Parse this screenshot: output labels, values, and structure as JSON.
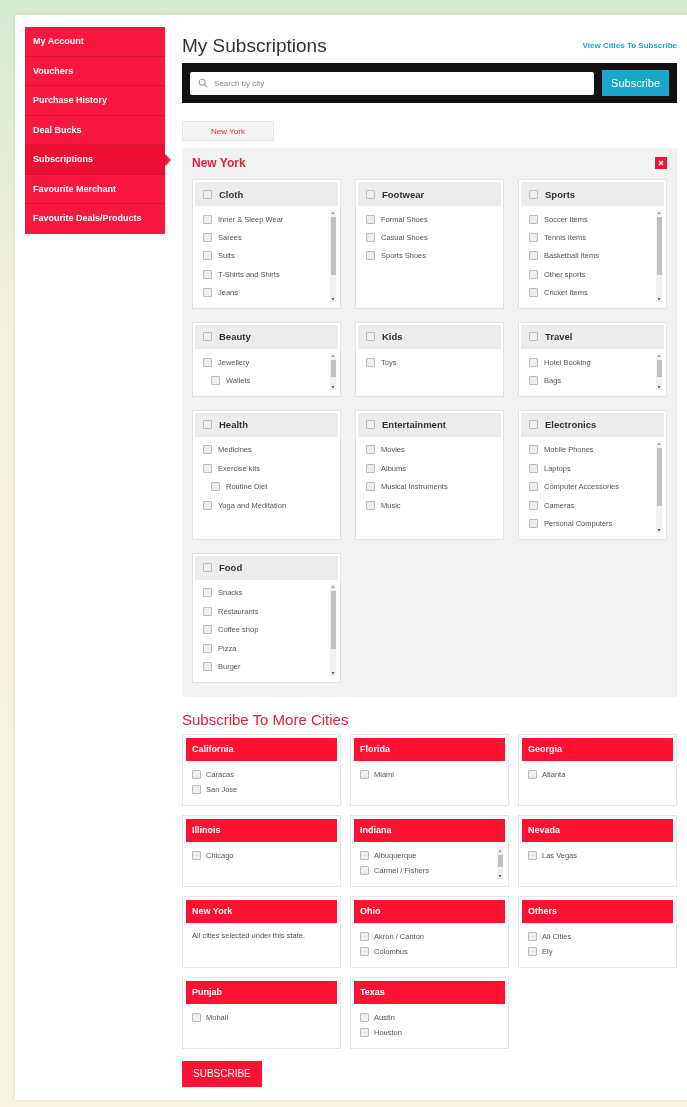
{
  "sidebar": {
    "items": [
      {
        "label": "My Account",
        "selected": false
      },
      {
        "label": "Vouchers",
        "selected": false
      },
      {
        "label": "Purchase History",
        "selected": false
      },
      {
        "label": "Deal Bucks",
        "selected": false
      },
      {
        "label": "Subscriptions",
        "selected": true
      },
      {
        "label": "Favourite Merchant",
        "selected": false
      },
      {
        "label": "Favourite Deals/Products",
        "selected": false
      }
    ]
  },
  "page_title": "My Subscriptions",
  "view_cities_link": "View Cities To Subscribe",
  "search": {
    "placeholder": "Search by city",
    "button": "Subscribe"
  },
  "city_tabs": [
    {
      "label": "New York",
      "selected": true
    }
  ],
  "city_panel": {
    "title": "New York",
    "categories": [
      {
        "name": "Cloth",
        "checked": false,
        "scrollable": true,
        "items": [
          {
            "name": "Inner & Sleep Wear",
            "checked": false
          },
          {
            "name": "Sarees",
            "checked": false
          },
          {
            "name": "Suits",
            "checked": false
          },
          {
            "name": "T-Shirts and Shirts",
            "checked": false
          },
          {
            "name": "Jeans",
            "checked": false
          }
        ]
      },
      {
        "name": "Footwear",
        "checked": false,
        "scrollable": false,
        "items": [
          {
            "name": "Formal Shoes",
            "checked": false
          },
          {
            "name": "Casual Shoes",
            "checked": false
          },
          {
            "name": "Sports Shoes",
            "checked": false
          }
        ]
      },
      {
        "name": "Sports",
        "checked": false,
        "scrollable": true,
        "items": [
          {
            "name": "Soccer Items",
            "checked": false
          },
          {
            "name": "Tennis Items",
            "checked": false
          },
          {
            "name": "Basketball Items",
            "checked": false
          },
          {
            "name": "Other sports",
            "checked": false
          },
          {
            "name": "Cricket Items",
            "checked": false
          }
        ]
      },
      {
        "name": "Beauty",
        "checked": false,
        "scrollable": true,
        "items": [
          {
            "name": "Jewellery",
            "checked": false,
            "children": [
              {
                "name": "Wallets",
                "checked": false
              }
            ]
          }
        ]
      },
      {
        "name": "Kids",
        "checked": false,
        "scrollable": false,
        "items": [
          {
            "name": "Toys",
            "checked": false
          }
        ]
      },
      {
        "name": "Travel",
        "checked": false,
        "scrollable": true,
        "items": [
          {
            "name": "Hotel Booking",
            "checked": false
          },
          {
            "name": "Bags",
            "checked": false
          }
        ]
      },
      {
        "name": "Health",
        "checked": false,
        "scrollable": false,
        "items": [
          {
            "name": "Medicines",
            "checked": false
          },
          {
            "name": "Exercise kits",
            "checked": false,
            "children": [
              {
                "name": "Routine Diet",
                "checked": false
              }
            ]
          },
          {
            "name": "Yoga and Meditation",
            "checked": false
          }
        ]
      },
      {
        "name": "Entertainment",
        "checked": false,
        "scrollable": false,
        "items": [
          {
            "name": "Movies",
            "checked": false
          },
          {
            "name": "Albums",
            "checked": false
          },
          {
            "name": "Musical Instruments",
            "checked": false
          },
          {
            "name": "Music",
            "checked": false
          }
        ]
      },
      {
        "name": "Electronics",
        "checked": false,
        "scrollable": true,
        "items": [
          {
            "name": "Mobile Phones",
            "checked": false
          },
          {
            "name": "Laptops",
            "checked": false
          },
          {
            "name": "Computer Accessories",
            "checked": false
          },
          {
            "name": "Cameras",
            "checked": false
          },
          {
            "name": "Personal Computers",
            "checked": false
          }
        ]
      },
      {
        "name": "Food",
        "checked": false,
        "scrollable": true,
        "items": [
          {
            "name": "Snacks",
            "checked": false
          },
          {
            "name": "Restaurants",
            "checked": false
          },
          {
            "name": "Coffee shop",
            "checked": false
          },
          {
            "name": "Pizza",
            "checked": false
          },
          {
            "name": "Burger",
            "checked": false
          }
        ]
      }
    ]
  },
  "more_cities": {
    "title": "Subscribe To More Cities",
    "states": [
      {
        "name": "California",
        "scrollable": false,
        "cities": [
          {
            "name": "Caracas",
            "checked": false
          },
          {
            "name": "San Jose",
            "checked": false
          }
        ]
      },
      {
        "name": "Florida",
        "scrollable": false,
        "cities": [
          {
            "name": "Miami",
            "checked": false
          }
        ]
      },
      {
        "name": "Georgia",
        "scrollable": false,
        "cities": [
          {
            "name": "Atlanta",
            "checked": false
          }
        ]
      },
      {
        "name": "Illinois",
        "scrollable": false,
        "cities": [
          {
            "name": "Chicago",
            "checked": false
          }
        ]
      },
      {
        "name": "Indiana",
        "scrollable": true,
        "cities": [
          {
            "name": "Albuquerque",
            "checked": false
          },
          {
            "name": "Carmel / Fishers",
            "checked": false
          }
        ]
      },
      {
        "name": "Nevada",
        "scrollable": false,
        "cities": [
          {
            "name": "Las Vegas",
            "checked": false
          }
        ]
      },
      {
        "name": "New York",
        "scrollable": false,
        "note": "All cities selected under this state."
      },
      {
        "name": "Ohio",
        "scrollable": false,
        "cities": [
          {
            "name": "Akron / Canton",
            "checked": false
          },
          {
            "name": "Colombus",
            "checked": false
          }
        ]
      },
      {
        "name": "Others",
        "scrollable": false,
        "cities": [
          {
            "name": "All Cities",
            "checked": false
          },
          {
            "name": "Ely",
            "checked": false
          }
        ]
      },
      {
        "name": "Punjab",
        "scrollable": false,
        "cities": [
          {
            "name": "Mohali",
            "checked": false
          }
        ]
      },
      {
        "name": "Texas",
        "scrollable": false,
        "cities": [
          {
            "name": "Austin",
            "checked": false
          },
          {
            "name": "Houston",
            "checked": false
          }
        ]
      }
    ],
    "button": "SUBSCRIBE"
  }
}
